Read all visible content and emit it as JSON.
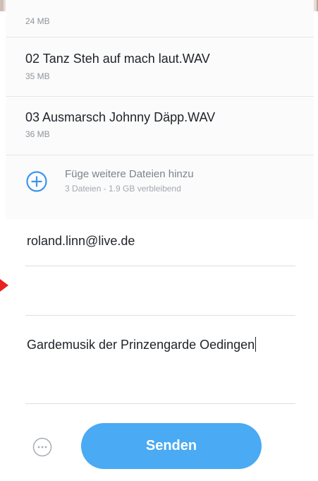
{
  "files": [
    {
      "name": "",
      "size": "24 MB"
    },
    {
      "name": "02 Tanz Steh auf mach laut.WAV",
      "size": "35 MB"
    },
    {
      "name": "03 Ausmarsch Johnny Däpp.WAV",
      "size": "36 MB"
    }
  ],
  "add_files": {
    "title": "Füge weitere Dateien hinzu",
    "subtitle": "3 Dateien - 1.9 GB verbleibend",
    "icon": "plus-circle-icon"
  },
  "form": {
    "email_to": "roland.linn@live.de",
    "email_from": "",
    "message": "Gardemusik der Prinzengarde Oedingen"
  },
  "footer": {
    "more_icon": "ellipsis-circle-icon",
    "send_label": "Senden"
  },
  "colors": {
    "accent": "#4aaaf3",
    "pointer": "#e8231f",
    "text": "#1e2328",
    "muted": "#8e949b"
  }
}
